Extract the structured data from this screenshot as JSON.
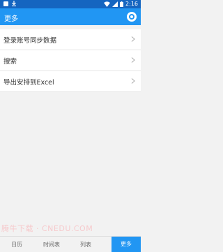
{
  "status_bar": {
    "time": "2:16",
    "icons": [
      "image-icon",
      "download-icon",
      "wifi-icon",
      "signal-icon",
      "battery-icon"
    ]
  },
  "app_bar": {
    "title": "更多",
    "settings_icon": "gear-icon",
    "color": "#2196f3"
  },
  "menu": {
    "items": [
      {
        "label": "登录账号同步数据"
      },
      {
        "label": "搜索"
      },
      {
        "label": "导出安排到Excel"
      }
    ]
  },
  "watermark": "腾牛下载 · CNEDU.COM",
  "tabs": [
    {
      "label": "日历"
    },
    {
      "label": "时间表"
    },
    {
      "label": "列表"
    },
    {
      "label": "更多",
      "active": true
    }
  ]
}
